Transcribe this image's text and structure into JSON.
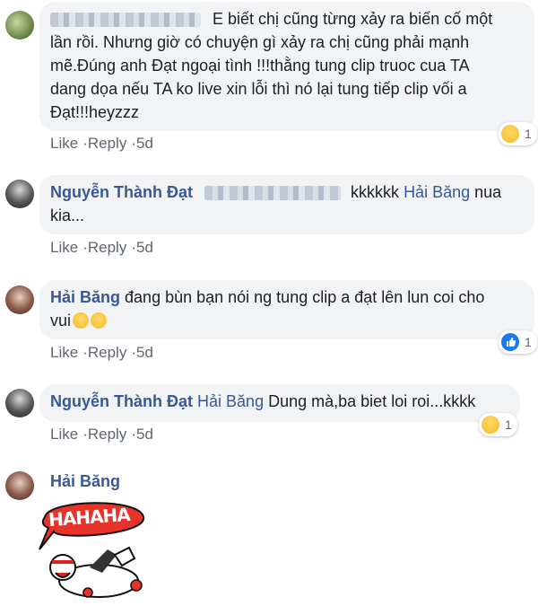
{
  "comments": [
    {
      "text": "E biết chị cũng từng xảy ra biến cố một lần rồi. Nhưng giờ có chuyện gì xảy ra chị cũng phải mạnh mẽ.Đúng anh Đạt ngoại tình !!!thằng tung clip truoc cua TA dang dọa nếu TA ko live xin lỗi thì nó lại tung tiếp clip vối a Đạt!!!heyzzz",
      "line1": "E biết chị cũng từng xảy ra biến cố một",
      "line2": "lần rồi. Nhưng giờ có chuyện gì xảy ra chị cũng phải mạnh",
      "line3": "mẽ.Đúng anh Đạt ngoại tình !!!thằng tung clip truoc cua TA",
      "line4": "dang dọa nếu TA ko live xin lỗi thì nó lại tung tiếp clip vối a",
      "line5": "Đạt!!!heyzzz",
      "like": "Like",
      "reply": "Reply",
      "time": "5d",
      "reaction_icon": "haha-icon",
      "reaction_count": "1"
    },
    {
      "author": "Nguyễn Thành Đạt",
      "text_a": "kkkkkk",
      "mention": "Hải Băng",
      "text_b": "nua",
      "line2": "kia...",
      "like": "Like",
      "reply": "Reply",
      "time": "5d"
    },
    {
      "author": "Hải Băng",
      "text_a": "đang bùn bạn nói ng tung clip a đạt lên lun coi cho",
      "line2": "vui",
      "like": "Like",
      "reply": "Reply",
      "time": "5d",
      "reaction_icon": "like-icon",
      "reaction_count": "1"
    },
    {
      "author": "Nguyễn Thành Đạt",
      "mention": "Hải Băng",
      "text_b": "Dung mà,ba biet loi roi...kkkk",
      "like": "Like",
      "reply": "Reply",
      "time": "5d",
      "reaction_icon": "haha-icon",
      "reaction_count": "1"
    },
    {
      "author": "Hải Băng",
      "sticker_text": "HAHAHA"
    }
  ],
  "colors": {
    "link": "#385898",
    "bubble": "#f2f3f5",
    "meta": "#606770",
    "like_blue": "#1877f2",
    "haha_yellow": "#f7b928",
    "sticker_red": "#e8332a"
  }
}
